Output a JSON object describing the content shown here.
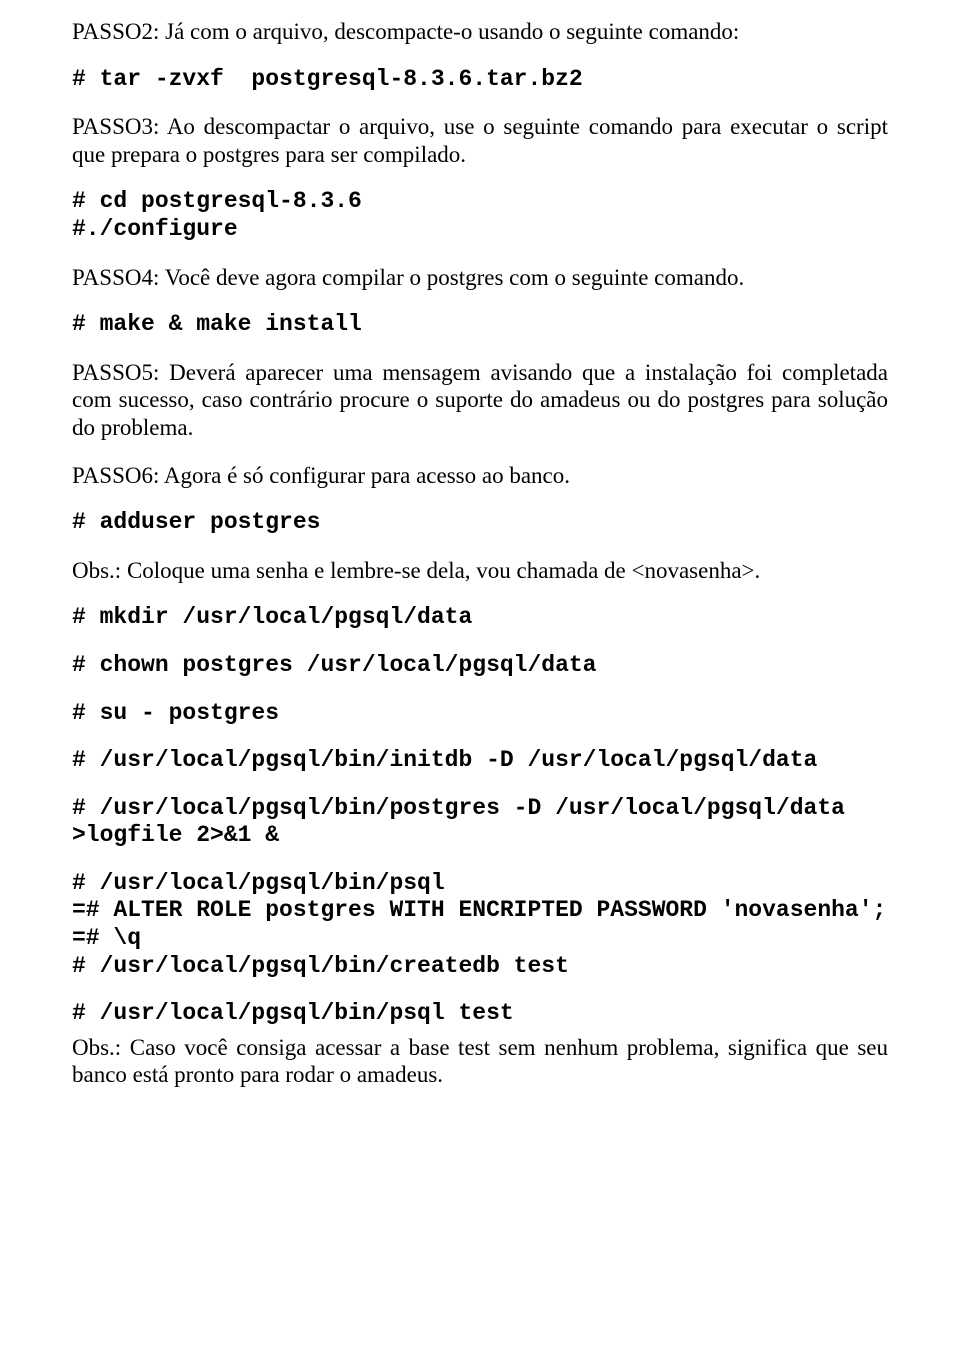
{
  "doc": {
    "p1": "PASSO2: Já com o arquivo, descompacte-o usando o seguinte comando:",
    "c1": "# tar -zvxf  postgresql-8.3.6.tar.bz2",
    "p2": "PASSO3: Ao descompactar o arquivo, use o seguinte comando para executar o script que prepara o postgres para ser compilado.",
    "c2": "# cd postgresql-8.3.6\n#./configure",
    "p3": "PASSO4: Você deve agora compilar o postgres com o seguinte comando.",
    "c3": "# make & make install",
    "p4": "PASSO5: Deverá aparecer uma mensagem avisando que a instalação foi completada com sucesso, caso contrário procure o suporte do amadeus ou do postgres para solução do problema.",
    "p5": "PASSO6: Agora é só configurar para acesso ao banco.",
    "c4": "# adduser postgres",
    "p6": "Obs.:  Coloque uma senha e lembre-se dela, vou chamada de <novasenha>.",
    "c5": "# mkdir /usr/local/pgsql/data",
    "c6": "# chown postgres /usr/local/pgsql/data",
    "c7": "# su - postgres",
    "c8": "# /usr/local/pgsql/bin/initdb -D /usr/local/pgsql/data",
    "c9": "# /usr/local/pgsql/bin/postgres -D /usr/local/pgsql/data >logfile 2>&1 &",
    "c10": "# /usr/local/pgsql/bin/psql\n=# ALTER ROLE postgres WITH ENCRIPTED PASSWORD 'novasenha';\n=# \\q\n# /usr/local/pgsql/bin/createdb test",
    "c11": "# /usr/local/pgsql/bin/psql test",
    "p7": "Obs.: Caso você consiga acessar a base test sem nenhum problema, significa que seu banco está pronto para rodar o amadeus."
  }
}
